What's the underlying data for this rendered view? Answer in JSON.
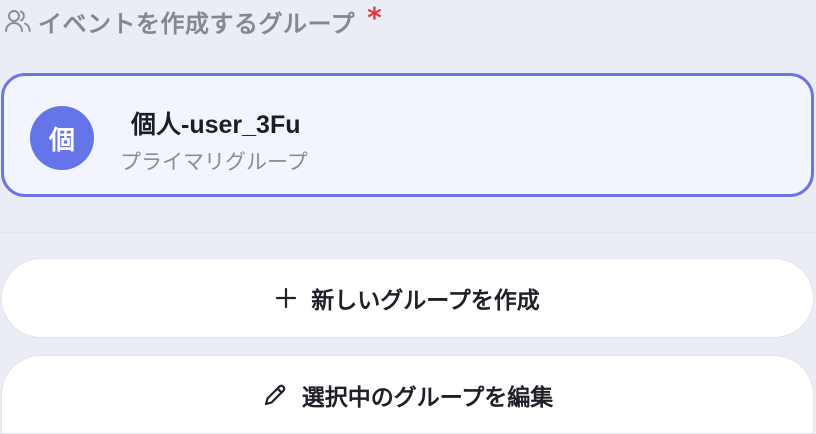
{
  "field": {
    "label": "イベントを作成するグループ",
    "required_mark": "*",
    "icon": "users-icon"
  },
  "selected_group": {
    "avatar_text": "個",
    "name": "個人-user_3Fu",
    "role": "プライマリグループ"
  },
  "actions": {
    "create_label": "新しいグループを作成",
    "create_icon": "plus-icon",
    "edit_label": "選択中のグループを編集",
    "edit_icon": "pencil-icon"
  },
  "colors": {
    "accent": "#6a76e4",
    "required": "#e0393e",
    "card_background": "#f2f5fe"
  }
}
